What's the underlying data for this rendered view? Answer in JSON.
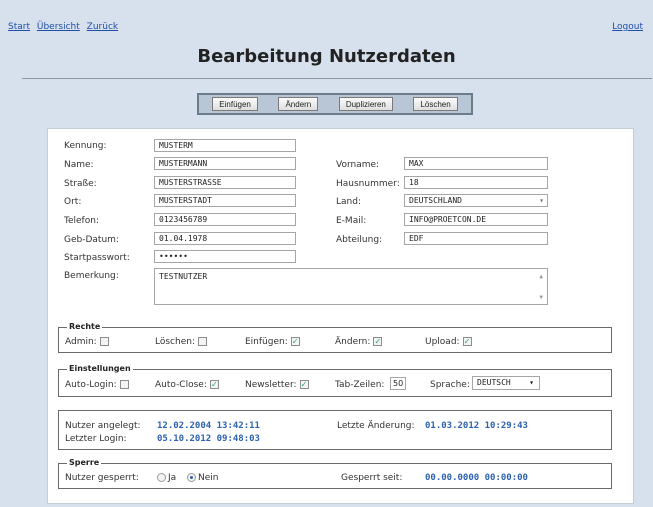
{
  "nav": {
    "start": "Start",
    "overview": "Übersicht",
    "back": "Zurück",
    "logout": "Logout"
  },
  "title": "Bearbeitung Nutzerdaten",
  "toolbar": {
    "insert": "Einfügen",
    "change": "Ändern",
    "duplicate": "Duplizieren",
    "delete": "Löschen"
  },
  "form": {
    "kennung": {
      "label": "Kennung:",
      "value": "MUSTERM"
    },
    "name": {
      "label": "Name:",
      "value": "MUSTERMANN"
    },
    "vorname": {
      "label": "Vorname:",
      "value": "MAX"
    },
    "strasse": {
      "label": "Straße:",
      "value": "MUSTERSTRASSE"
    },
    "hausnummer": {
      "label": "Hausnummer:",
      "value": "18"
    },
    "ort": {
      "label": "Ort:",
      "value": "MUSTERSTADT"
    },
    "land": {
      "label": "Land:",
      "value": "DEUTSCHLAND"
    },
    "telefon": {
      "label": "Telefon:",
      "value": "0123456789"
    },
    "email": {
      "label": "E-Mail:",
      "value": "INFO@PROETCON.DE"
    },
    "geburtsdatum": {
      "label": "Geb-Datum:",
      "value": "01.04.1978"
    },
    "abteilung": {
      "label": "Abteilung:",
      "value": "EDF"
    },
    "startpasswort": {
      "label": "Startpasswort:",
      "value": "••••••"
    },
    "bemerkung": {
      "label": "Bemerkung:",
      "value": "TESTNUTZER"
    }
  },
  "rechte": {
    "legend": "Rechte",
    "admin": {
      "label": "Admin:",
      "checked": false
    },
    "loeschen": {
      "label": "Löschen:",
      "checked": false
    },
    "einfuegen": {
      "label": "Einfügen:",
      "checked": true
    },
    "aendern": {
      "label": "Ändern:",
      "checked": true
    },
    "upload": {
      "label": "Upload:",
      "checked": true
    }
  },
  "einstellungen": {
    "legend": "Einstellungen",
    "autologin": {
      "label": "Auto-Login:",
      "checked": false
    },
    "autoclose": {
      "label": "Auto-Close:",
      "checked": true
    },
    "newsletter": {
      "label": "Newsletter:",
      "checked": true
    },
    "tabzeilen": {
      "label": "Tab-Zeilen:",
      "value": "50"
    },
    "sprache": {
      "label": "Sprache:",
      "value": "DEUTSCH"
    }
  },
  "info": {
    "angelegt_label": "Nutzer angelegt:",
    "angelegt_value": "12.02.2004 13:42:11",
    "login_label": "Letzter Login:",
    "login_value": "05.10.2012 09:48:03",
    "aenderung_label": "Letzte Änderung:",
    "aenderung_value": "01.03.2012 10:29:43"
  },
  "sperre": {
    "legend": "Sperre",
    "label": "Nutzer gesperrt:",
    "ja": "Ja",
    "nein": "Nein",
    "selected": "Nein",
    "seit_label": "Gesperrt seit:",
    "seit_value": "00.00.0000 00:00:00"
  }
}
